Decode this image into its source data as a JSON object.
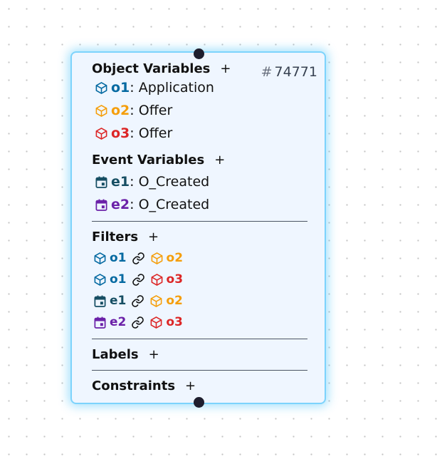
{
  "node": {
    "id_hash": "#",
    "id_number": "74771",
    "object_variables": {
      "title": "Object Variables",
      "add_label": "+",
      "items": [
        {
          "name": "o1",
          "type": "Application",
          "color": "#0369a1",
          "icon": "cube-icon"
        },
        {
          "name": "o2",
          "type": "Offer",
          "color": "#f59e0b",
          "icon": "cube-icon"
        },
        {
          "name": "o3",
          "type": "Offer",
          "color": "#dc2626",
          "icon": "cube-icon"
        }
      ]
    },
    "event_variables": {
      "title": "Event Variables",
      "add_label": "+",
      "items": [
        {
          "name": "e1",
          "type": "O_Created",
          "color": "#164e63",
          "icon": "calendar-icon"
        },
        {
          "name": "e2",
          "type": "O_Created",
          "color": "#6b21a8",
          "icon": "calendar-icon"
        }
      ]
    },
    "filters": {
      "title": "Filters",
      "add_label": "+",
      "items": [
        {
          "left": "o1",
          "right": "o2"
        },
        {
          "left": "o1",
          "right": "o3"
        },
        {
          "left": "e1",
          "right": "o2"
        },
        {
          "left": "e2",
          "right": "o3"
        }
      ]
    },
    "labels": {
      "title": "Labels",
      "add_label": "+"
    },
    "constraints": {
      "title": "Constraints",
      "add_label": "+"
    }
  }
}
